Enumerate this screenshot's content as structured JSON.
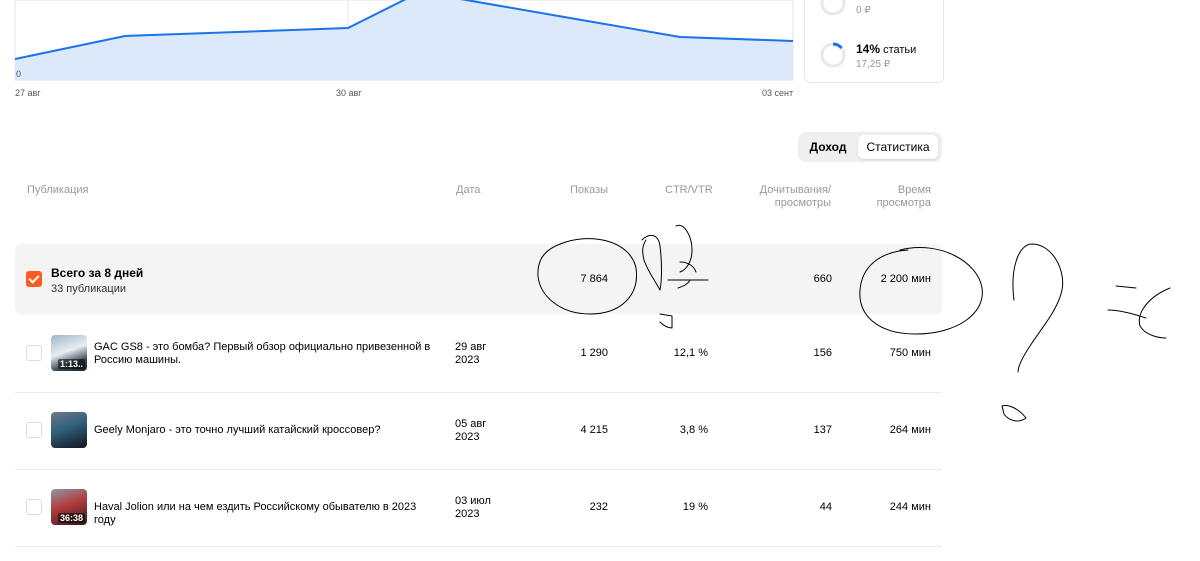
{
  "chart": {
    "x_labels": [
      "27 авг",
      "30 авг",
      "03 сент"
    ],
    "y_zero_label": "0",
    "colors": {
      "line": "#1a73e8",
      "fill": "#dbe9fb"
    }
  },
  "side_card": {
    "items": [
      {
        "sub": "0 ₽"
      },
      {
        "percent": "14%",
        "label": "статьи",
        "sub": "17,25 ₽"
      }
    ]
  },
  "toggle": {
    "income": "Доход",
    "stats": "Статистика"
  },
  "table": {
    "headers": {
      "publication": "Публикация",
      "date": "Дата",
      "shows": "Показы",
      "ctr": "CTR/VTR",
      "reads_1": "Дочитывания/",
      "reads_2": "просмотры",
      "time_1": "Время",
      "time_2": "просмотра"
    },
    "total": {
      "title": "Всего за 8 дней",
      "subtitle": "33 публикации",
      "shows": "7 864",
      "reads": "660",
      "time": "2 200 мин"
    },
    "rows": [
      {
        "title": "GAC GS8 - это бомба? Первый обзор официально привезенной в Россию машины.",
        "duration": "1:13..",
        "date_1": "29 авг",
        "date_2": "2023",
        "shows": "1 290",
        "ctr": "12,1 %",
        "reads": "156",
        "time": "750 мин"
      },
      {
        "title": "Geely Monjaro - это точно лучший катайский кроссовер?",
        "duration": "",
        "date_1": "05 авг",
        "date_2": "2023",
        "shows": "4 215",
        "ctr": "3,8 %",
        "reads": "137",
        "time": "264 мин"
      },
      {
        "title": "Haval Jolion или на чем ездить Российскому обывателю в 2023 году",
        "duration": "36:38",
        "date_1": "03 июл",
        "date_2": "2023",
        "shows": "232",
        "ctr": "19 %",
        "reads": "44",
        "time": "244 мин"
      }
    ]
  },
  "colors": {
    "accent": "#ff5a1f"
  }
}
